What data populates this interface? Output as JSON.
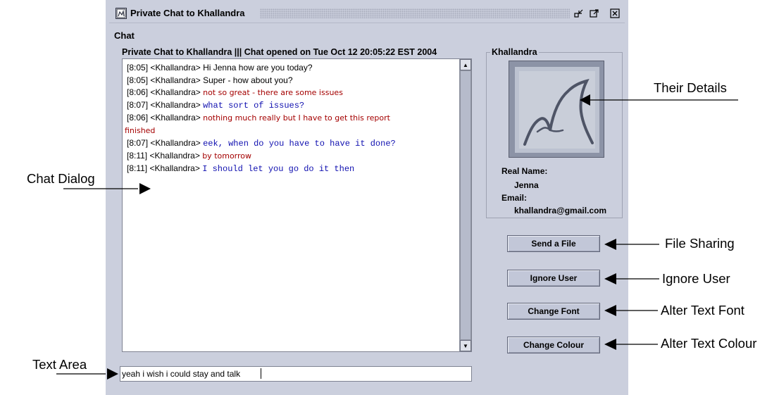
{
  "window": {
    "title": "Private Chat to Khallandra",
    "menu_chat": "Chat"
  },
  "chat": {
    "header": "Private Chat to Khallandra ||| Chat opened on Tue Oct 12 20:05:22 EST 2004",
    "lines": [
      {
        "time": "[8:05]",
        "nick": "<Khallandra>",
        "text": "Hi Jenna how are you today?",
        "style": "black"
      },
      {
        "time": "[8:05]",
        "nick": "<Khallandra>",
        "text": "Super - how about you?",
        "style": "black"
      },
      {
        "time": "[8:06]",
        "nick": "<Khallandra>",
        "text": "not so great - there are some issues",
        "style": "red"
      },
      {
        "time": "[8:07]",
        "nick": "<Khallandra>",
        "text": "what sort of issues?",
        "style": "blue"
      },
      {
        "time": "[8:06]",
        "nick": "<Khallandra>",
        "text": "nothing much really but I have to get this report",
        "style": "red"
      },
      {
        "time": "",
        "nick": "",
        "text": "finished",
        "style": "red-wrap"
      },
      {
        "time": "[8:07]",
        "nick": "<Khallandra>",
        "text": "eek, when do you have to have it done?",
        "style": "blue"
      },
      {
        "time": "[8:11]",
        "nick": "<Khallandra>",
        "text": "by tomorrow",
        "style": "red"
      },
      {
        "time": "[8:11]",
        "nick": "<Khallandra>",
        "text": "I should let you go do it then",
        "style": "blue"
      }
    ],
    "input_value": "yeah i wish i could stay and talk"
  },
  "details": {
    "group_label": "Khallandra",
    "real_name_label": "Real Name:",
    "real_name": "Jenna",
    "email_label": "Email:",
    "email": "khallandra@gmail.com"
  },
  "buttons": {
    "send_file": "Send a File",
    "ignore_user": "Ignore User",
    "change_font": "Change Font",
    "change_colour": "Change Colour"
  },
  "annotations": {
    "their_details": "Their Details",
    "chat_dialog": "Chat Dialog",
    "file_sharing": "File Sharing",
    "ignore_user": "Ignore User",
    "alter_text_font": "Alter Text Font",
    "alter_text_colour": "Alter Text Colour",
    "text_area": "Text Area"
  },
  "colors": {
    "window_bg": "#cbcfdd",
    "message_red": "#a40000",
    "message_blue": "#1010b0"
  }
}
